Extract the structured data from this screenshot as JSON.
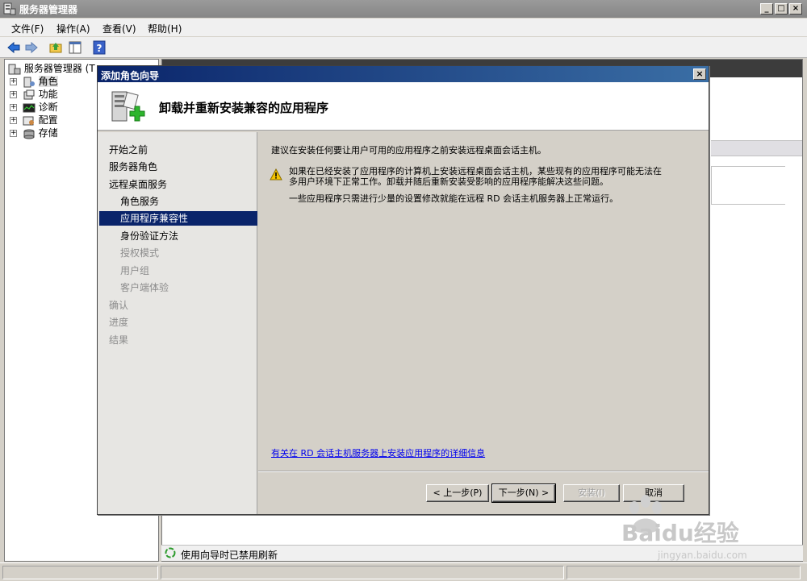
{
  "window": {
    "title": "服务器管理器"
  },
  "menu": [
    {
      "label": "文件(F)"
    },
    {
      "label": "操作(A)"
    },
    {
      "label": "查看(V)"
    },
    {
      "label": "帮助(H)"
    }
  ],
  "tree": {
    "root": "服务器管理器 (T",
    "items": [
      {
        "label": "角色"
      },
      {
        "label": "功能"
      },
      {
        "label": "诊断"
      },
      {
        "label": "配置"
      },
      {
        "label": "存储"
      }
    ]
  },
  "dialog": {
    "title": "添加角色向导",
    "header_title": "卸载并重新安装兼容的应用程序",
    "nav": [
      {
        "label": "开始之前",
        "level": 0,
        "state": "normal"
      },
      {
        "label": "服务器角色",
        "level": 0,
        "state": "normal"
      },
      {
        "label": "远程桌面服务",
        "level": 0,
        "state": "normal"
      },
      {
        "label": "角色服务",
        "level": 1,
        "state": "normal"
      },
      {
        "label": "应用程序兼容性",
        "level": 1,
        "state": "selected"
      },
      {
        "label": "身份验证方法",
        "level": 1,
        "state": "normal"
      },
      {
        "label": "授权模式",
        "level": 1,
        "state": "disabled"
      },
      {
        "label": "用户组",
        "level": 1,
        "state": "disabled"
      },
      {
        "label": "客户端体验",
        "level": 1,
        "state": "disabled"
      },
      {
        "label": "确认",
        "level": 0,
        "state": "disabled"
      },
      {
        "label": "进度",
        "level": 0,
        "state": "disabled"
      },
      {
        "label": "结果",
        "level": 0,
        "state": "disabled"
      }
    ],
    "intro": "建议在安装任何要让用户可用的应用程序之前安装远程桌面会话主机。",
    "warning_line1": "如果在已经安装了应用程序的计算机上安装远程桌面会话主机，某些现有的应用程序可能无法在",
    "warning_line2": "多用户环境下正常工作。卸载并随后重新安装受影响的应用程序能解决这些问题。",
    "note": "一些应用程序只需进行少量的设置修改就能在远程 RD 会话主机服务器上正常运行。",
    "link": "有关在 RD 会话主机服务器上安装应用程序的详细信息",
    "buttons": {
      "back": "< 上一步(P)",
      "next": "下一步(N) >",
      "install": "安装(I)",
      "cancel": "取消"
    }
  },
  "status": {
    "text": "使用向导时已禁用刷新"
  },
  "watermark": {
    "brand": "Baidu经验",
    "url": "jingyan.baidu.com"
  },
  "colors": {
    "selection": "#0a246a",
    "dialog_title_start": "#0a246a",
    "link": "#0000ee",
    "warning": "#f5c400"
  }
}
